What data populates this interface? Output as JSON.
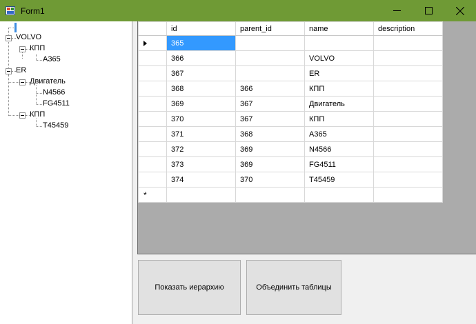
{
  "window": {
    "title": "Form1",
    "icon": "winforms-app-icon"
  },
  "tree": {
    "nodes": [
      {
        "label": "VOLVO",
        "level": 0,
        "expanded": true
      },
      {
        "label": "КПП",
        "level": 1,
        "expanded": true
      },
      {
        "label": "A365",
        "level": 2
      },
      {
        "label": "ER",
        "level": 0,
        "expanded": true
      },
      {
        "label": "Двигатель",
        "level": 1,
        "expanded": true
      },
      {
        "label": "N4566",
        "level": 2
      },
      {
        "label": "FG4511",
        "level": 2
      },
      {
        "label": "КПП",
        "level": 1,
        "expanded": true
      },
      {
        "label": "T45459",
        "level": 2
      }
    ]
  },
  "grid": {
    "columns": [
      "id",
      "parent_id",
      "name",
      "description"
    ],
    "rows": [
      [
        "365",
        "",
        "",
        ""
      ],
      [
        "366",
        "",
        "VOLVO",
        ""
      ],
      [
        "367",
        "",
        "ER",
        ""
      ],
      [
        "368",
        "366",
        "КПП",
        ""
      ],
      [
        "369",
        "367",
        "Двигатель",
        ""
      ],
      [
        "370",
        "367",
        "КПП",
        ""
      ],
      [
        "371",
        "368",
        "A365",
        ""
      ],
      [
        "372",
        "369",
        "N4566",
        ""
      ],
      [
        "373",
        "369",
        "FG4511",
        ""
      ],
      [
        "374",
        "370",
        "T45459",
        ""
      ]
    ],
    "current_row_indicator": "row-arrow-icon",
    "new_row_indicator": "new-row-star-icon"
  },
  "buttons": {
    "show_hierarchy": "Показать иерархию",
    "join_tables": "Объединить таблицы"
  },
  "colors": {
    "titlebar": "#6f9a35",
    "selection": "#3399ff",
    "grid_background": "#ababab"
  }
}
